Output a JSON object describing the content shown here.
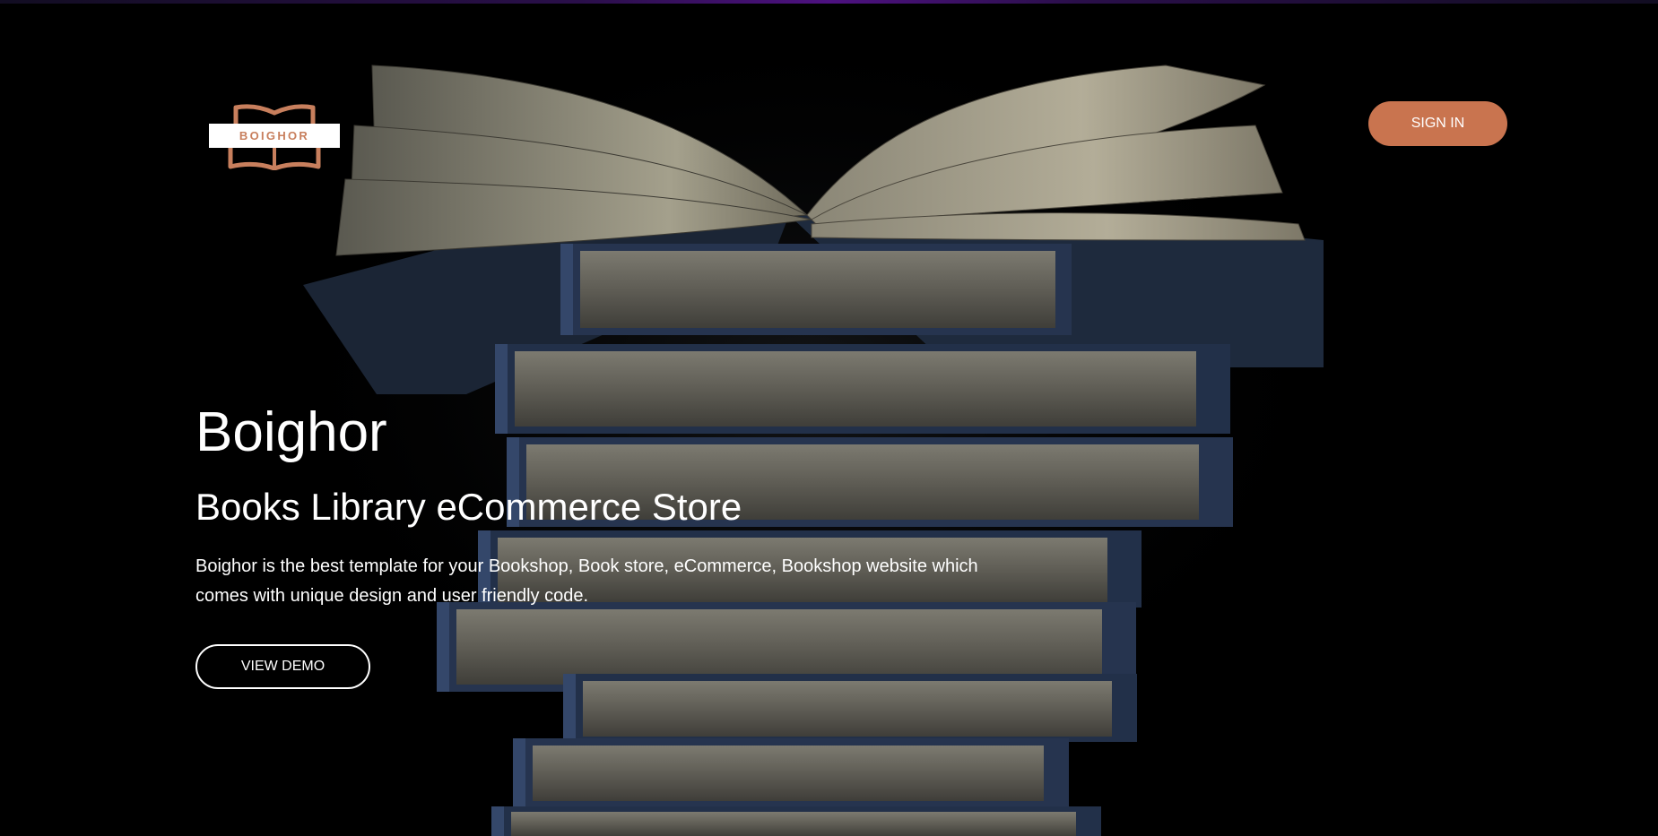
{
  "header": {
    "logo_text": "BOIGHOR",
    "sign_in_label": "SIGN IN"
  },
  "hero": {
    "title": "Boighor",
    "subtitle": "Books Library eCommerce Store",
    "description": "Boighor is the best template for your Bookshop, Book store, eCommerce, Bookshop website which comes with unique design and user friendly code.",
    "cta_label": "VIEW DEMO"
  },
  "colors": {
    "accent": "#c9744f",
    "logo": "#c87f5d",
    "background": "#000000",
    "cover": "#2b3a55"
  }
}
